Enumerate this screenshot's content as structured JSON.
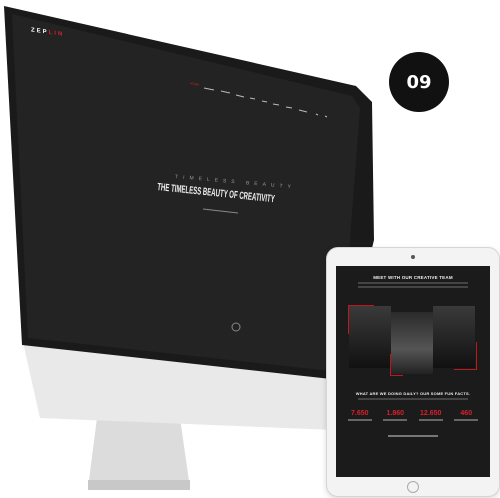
{
  "badge": "09",
  "monitor": {
    "logo": {
      "part1": "ZEP",
      "part2": "LIN"
    },
    "nav_active": "HOME",
    "hero_subtitle": "TIMELESS BEAUTY",
    "hero_title": "THE TIMELESS BEAUTY OF CREATIVITY"
  },
  "tablet": {
    "team_heading": "MEET WITH OUR CREATIVE TEAM",
    "facts_heading": "WHAT ARE WE DOING DAILY? OUR SOME FUN FACTS.",
    "facts": [
      {
        "value": "7.650"
      },
      {
        "value": "1.860"
      },
      {
        "value": "12.650"
      },
      {
        "value": "460"
      }
    ]
  },
  "colors": {
    "accent": "#d2232a",
    "screen": "#1c1c1c"
  }
}
